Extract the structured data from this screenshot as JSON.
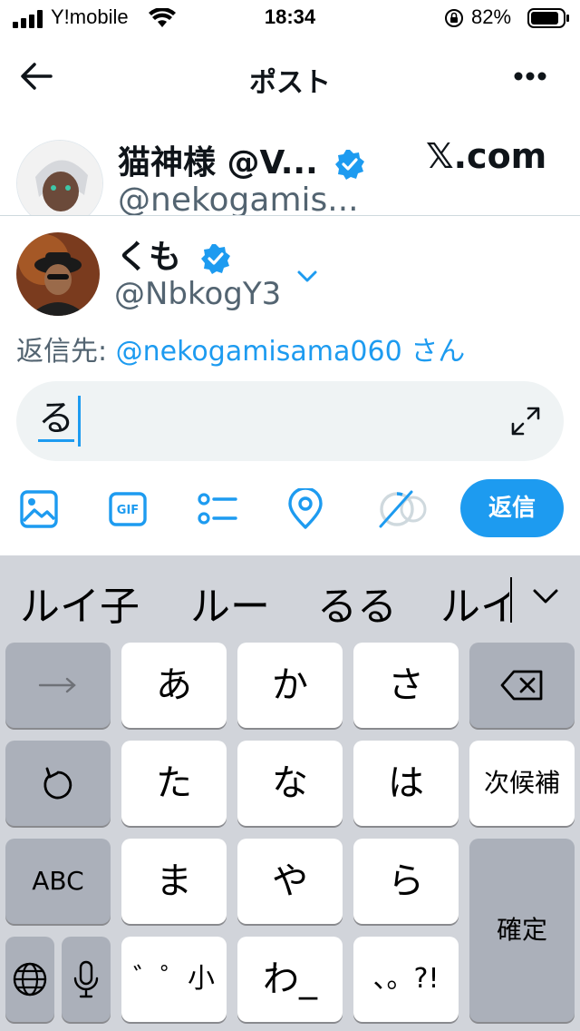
{
  "status_bar": {
    "carrier": "Y!mobile",
    "time": "18:34",
    "battery": "82%"
  },
  "header": {
    "title": "ポスト"
  },
  "original_post": {
    "author_name": "猫神様 @V...",
    "author_handle": "@nekogamis...",
    "watermark": "𝕏.com"
  },
  "composer": {
    "user_name": "くも",
    "user_handle": "@NbkogY3",
    "reply_to_label": "返信先: ",
    "reply_to_mention": "@nekogamisama060",
    "reply_to_suffix": " さん",
    "text": "る",
    "reply_button": "返信"
  },
  "toolbar": {
    "icons": [
      "image-icon",
      "gif-icon",
      "poll-icon",
      "location-icon",
      "character-count-icon"
    ],
    "gif_label": "GIF"
  },
  "keyboard": {
    "candidates": [
      "ルイ子",
      "ルー",
      "るる",
      "ルイ"
    ],
    "keys": {
      "a": "あ",
      "ka": "か",
      "sa": "さ",
      "ta": "た",
      "na": "な",
      "ha": "は",
      "next_candidate": "次候補",
      "abc": "ABC",
      "ma": "ま",
      "ya": "や",
      "ra": "ら",
      "confirm": "確定",
      "dakuten": "゛゜小",
      "wa": "わ_",
      "punct": "、。?!"
    }
  },
  "colors": {
    "accent": "#1d9bf0",
    "secondary_text": "#536471",
    "keyboard_bg": "#d1d4da",
    "dark_key": "#abb0ba"
  }
}
